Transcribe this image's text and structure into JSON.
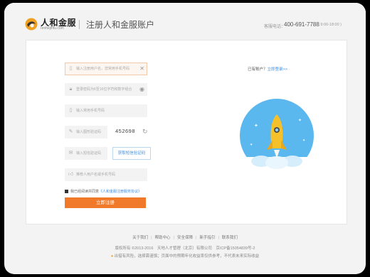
{
  "header": {
    "logo_text": "人和金服",
    "logo_sub": "renhejinfu.com",
    "title": "注册人和金服账户",
    "hotline_label": "客服电话：",
    "hotline": "400-691-7788",
    "hours": "( 9:00-18:00 )"
  },
  "form": {
    "phone_placeholder": "输入注册用户名，您常用手机号码",
    "password_placeholder": "登录密码为6至16位字符和数字组合",
    "phone2_placeholder": "输入常用手机号码",
    "captcha_placeholder": "输入图形验证码",
    "captcha_value": "452698",
    "sms_placeholder": "输入短信验证码",
    "sms_button": "获取短信验证码",
    "referrer_placeholder": "推荐人用户名或手机号码",
    "agree_text": "我已经阅读并同意",
    "agree_link": "《人和金服注册服务协议》",
    "submit": "立即注册"
  },
  "side": {
    "login_prompt": "已有账户？",
    "login_link": "立即登录>>"
  },
  "footer": {
    "links": [
      "关于我们",
      "帮助中心",
      "安全保障",
      "新手指引",
      "联系我们"
    ],
    "copyright": "版权所有 ©2013-2016　天地人才管理（北京）有限公司　京ICP备15054839号-2",
    "note": "出借有风险，选择需谨慎；页面中的预期年化收益率仅供参考，不代表未来实际收益"
  },
  "colors": {
    "accent": "#f07a2a",
    "link": "#3a8ee6",
    "circle": "#5bb8ee"
  }
}
